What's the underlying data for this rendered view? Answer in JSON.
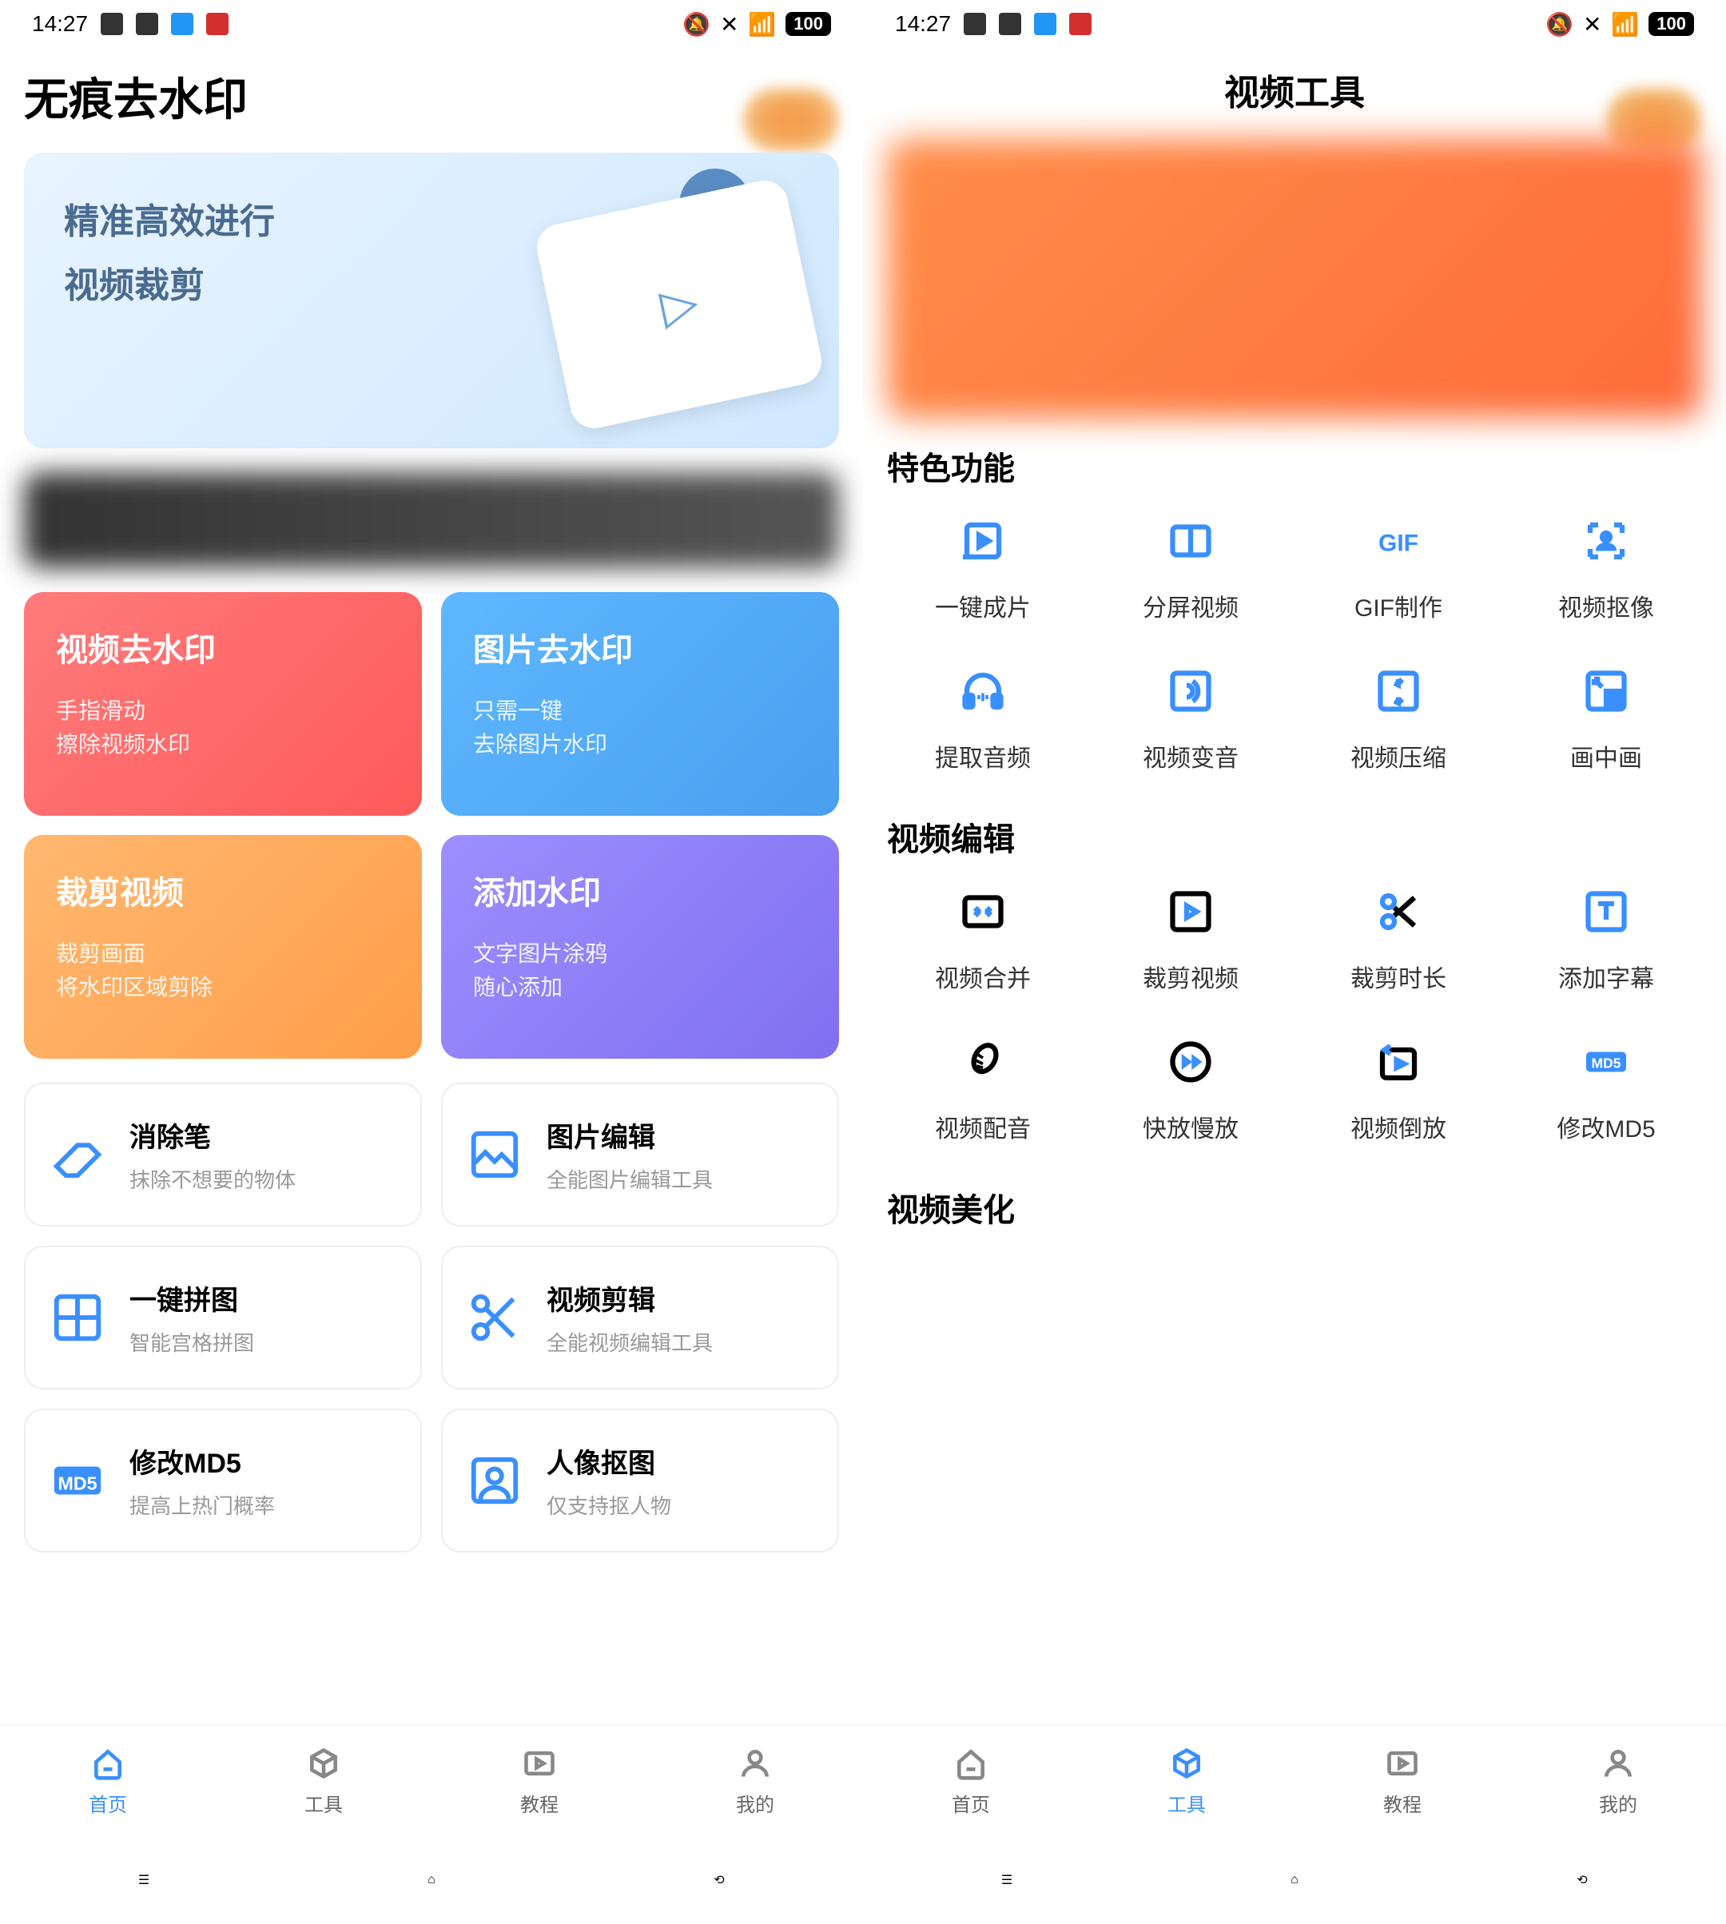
{
  "status": {
    "time": "14:27",
    "battery": "100"
  },
  "left": {
    "title": "无痕去水印",
    "banner": {
      "line1": "精准高效进行",
      "line2": "视频裁剪"
    },
    "cards": [
      {
        "title": "视频去水印",
        "sub1": "手指滑动",
        "sub2": "擦除视频水印",
        "cls": "red"
      },
      {
        "title": "图片去水印",
        "sub1": "只需一键",
        "sub2": "去除图片水印",
        "cls": "blue"
      },
      {
        "title": "裁剪视频",
        "sub1": "裁剪画面",
        "sub2": "将水印区域剪除",
        "cls": "orange"
      },
      {
        "title": "添加水印",
        "sub1": "文字图片涂鸦",
        "sub2": "随心添加",
        "cls": "purple"
      }
    ],
    "small": [
      {
        "title": "消除笔",
        "sub": "抹除不想要的物体",
        "icon": "eraser"
      },
      {
        "title": "图片编辑",
        "sub": "全能图片编辑工具",
        "icon": "image-edit"
      },
      {
        "title": "一键拼图",
        "sub": "智能宫格拼图",
        "icon": "grid"
      },
      {
        "title": "视频剪辑",
        "sub": "全能视频编辑工具",
        "icon": "cut"
      },
      {
        "title": "修改MD5",
        "sub": "提高上热门概率",
        "icon": "md5"
      },
      {
        "title": "人像抠图",
        "sub": "仅支持抠人物",
        "icon": "person"
      }
    ]
  },
  "right": {
    "title": "视频工具",
    "sections": [
      {
        "title": "特色功能",
        "items": [
          {
            "label": "一键成片",
            "icon": "play-in"
          },
          {
            "label": "分屏视频",
            "icon": "split"
          },
          {
            "label": "GIF制作",
            "icon": "gif"
          },
          {
            "label": "视频抠像",
            "icon": "person-scan"
          },
          {
            "label": "提取音频",
            "icon": "headphone"
          },
          {
            "label": "视频变音",
            "icon": "sound"
          },
          {
            "label": "视频压缩",
            "icon": "compress"
          },
          {
            "label": "画中画",
            "icon": "pip"
          }
        ]
      },
      {
        "title": "视频编辑",
        "items": [
          {
            "label": "视频合并",
            "icon": "merge"
          },
          {
            "label": "裁剪视频",
            "icon": "crop"
          },
          {
            "label": "裁剪时长",
            "icon": "cut-time"
          },
          {
            "label": "添加字幕",
            "icon": "text"
          },
          {
            "label": "视频配音",
            "icon": "mic"
          },
          {
            "label": "快放慢放",
            "icon": "speed"
          },
          {
            "label": "视频倒放",
            "icon": "reverse"
          },
          {
            "label": "修改MD5",
            "icon": "md5b"
          }
        ]
      },
      {
        "title": "视频美化",
        "items": []
      }
    ]
  },
  "nav": [
    {
      "label": "首页",
      "icon": "home"
    },
    {
      "label": "工具",
      "icon": "cube"
    },
    {
      "label": "教程",
      "icon": "play"
    },
    {
      "label": "我的",
      "icon": "user"
    }
  ]
}
